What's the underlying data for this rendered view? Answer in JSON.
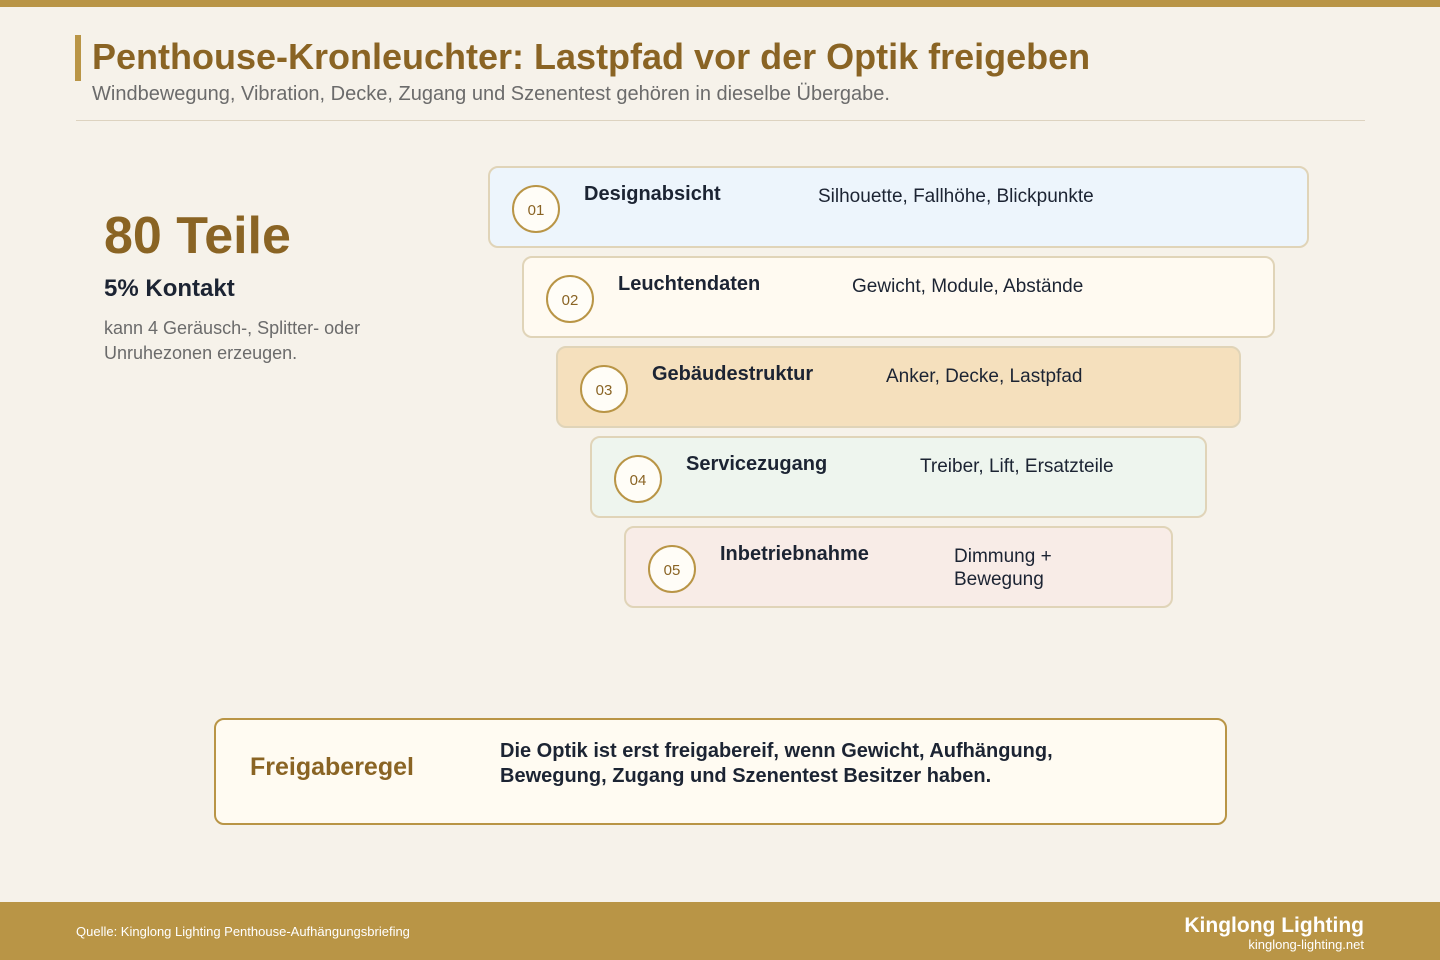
{
  "header": {
    "title": "Penthouse-Kronleuchter: Lastpfad vor der Optik freigeben",
    "subtitle": "Windbewegung, Vibration, Decke, Zugang und Szenentest gehören in dieselbe Übergabe."
  },
  "kpi": {
    "value": "80 Teile",
    "label": "5% Kontakt",
    "note": "kann 4 Geräusch-, Splitter- oder Unruhezonen erzeugen."
  },
  "steps": [
    {
      "number": "01",
      "title": "Designabsicht",
      "desc": "Silhouette, Fallhöhe, Blickpunkte",
      "color": "#edf5fc"
    },
    {
      "number": "02",
      "title": "Leuchtendaten",
      "desc": "Gewicht, Module, Abstände",
      "color": "#fffaf1"
    },
    {
      "number": "03",
      "title": "Gebäudestruktur",
      "desc": "Anker, Decke, Lastpfad",
      "color": "#f5e0bd"
    },
    {
      "number": "04",
      "title": "Servicezugang",
      "desc": "Treiber, Lift, Ersatzteile",
      "color": "#eef5ee"
    },
    {
      "number": "05",
      "title": "Inbetriebnahme",
      "desc": "Dimmung + Bewegung",
      "color": "#f8ece7"
    }
  ],
  "rule": {
    "label": "Freigaberegel",
    "text": "Die Optik ist erst freigabereif, wenn Gewicht, Aufhängung, Bewegung, Zugang und Szenentest Besitzer haben."
  },
  "footer": {
    "source": "Quelle: Kinglong Lighting Penthouse-Aufhängungsbriefing",
    "brand": "Kinglong Lighting",
    "url": "kinglong-lighting.net"
  },
  "colors": {
    "accent": "#b99546",
    "accent_text": "#8a6424",
    "background": "#f6f2ea"
  }
}
